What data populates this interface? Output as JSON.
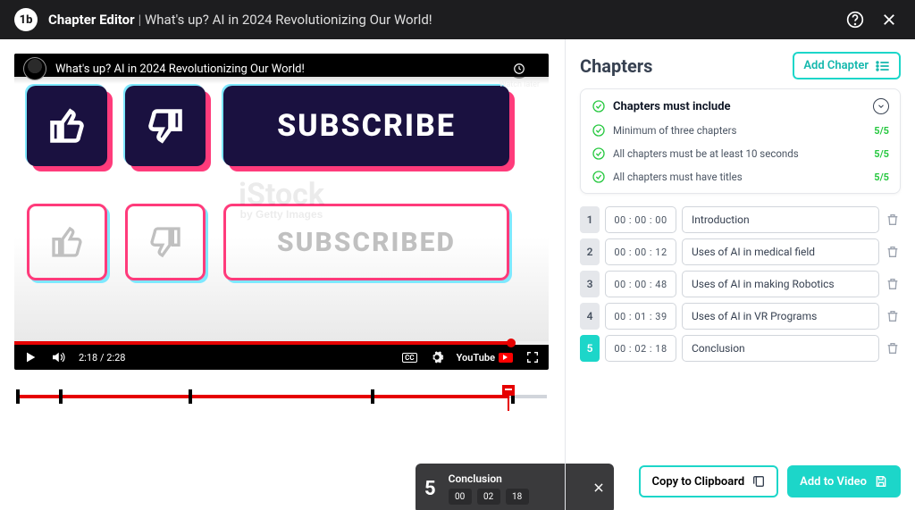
{
  "header": {
    "app_title": "Chapter Editor",
    "separator": "|",
    "video_title": "What's up? AI in 2024 Revolutionizing Our World!"
  },
  "player": {
    "video_overlay_title": "What's up? AI in 2024 Revolutionizing Our World!",
    "watch_later": "Watch later",
    "current_time": "2:18",
    "duration": "2:28",
    "cc_label": "CC",
    "youtube_label": "YouTube",
    "frame_text": {
      "subscribe": "SUBSCRIBE",
      "subscribed": "SUBSCRIBED",
      "watermark": "iStock",
      "watermark_by": "by Getty Images"
    },
    "progress_percent": 93
  },
  "timeline": {
    "playhead_percent": 92.7,
    "tooltip": {
      "index": "5",
      "title": "Conclusion",
      "hh": "00",
      "mm": "02",
      "ss": "18"
    }
  },
  "sidebar": {
    "heading": "Chapters",
    "add_button": "Add Chapter",
    "rules_heading": "Chapters must include",
    "rules": [
      {
        "text": "Minimum of three chapters",
        "status": "5/5"
      },
      {
        "text": "All chapters must be at least 10 seconds",
        "status": "5/5"
      },
      {
        "text": "All chapters must have titles",
        "status": "5/5"
      }
    ],
    "chapters": [
      {
        "n": "1",
        "time": "00 : 00 : 00",
        "title": "Introduction",
        "active": false
      },
      {
        "n": "2",
        "time": "00 : 00 : 12",
        "title": "Uses of AI in medical field",
        "active": false
      },
      {
        "n": "3",
        "time": "00 : 00 : 48",
        "title": "Uses of AI in making Robotics",
        "active": false
      },
      {
        "n": "4",
        "time": "00 : 01 : 39",
        "title": "Uses of AI in VR Programs",
        "active": false
      },
      {
        "n": "5",
        "time": "00 : 02 : 18",
        "title": "Conclusion",
        "active": true
      }
    ]
  },
  "footer": {
    "copy_label": "Copy to Clipboard",
    "add_video_label": "Add to Video"
  }
}
